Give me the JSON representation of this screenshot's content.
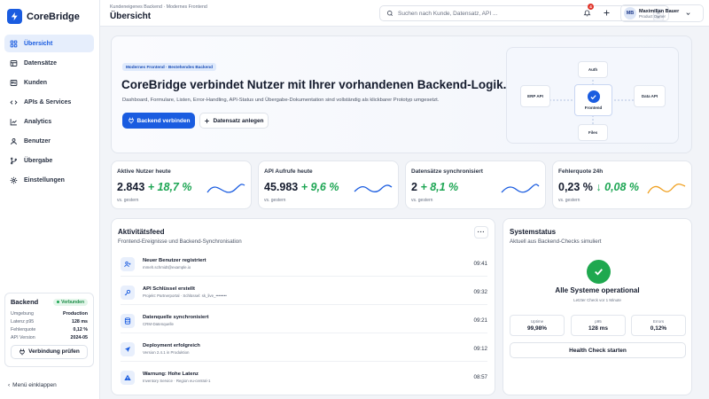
{
  "brand": {
    "name": "CoreBridge",
    "accent": "#1a5ce0",
    "success": "#1ea654",
    "warning": "#f0a020",
    "icon": "bolt-icon"
  },
  "sidebar": {
    "items": [
      {
        "label": "Übersicht",
        "icon": "grid-icon",
        "active": true
      },
      {
        "label": "Datensätze",
        "icon": "table-icon"
      },
      {
        "label": "Kunden",
        "icon": "user-icon"
      },
      {
        "label": "APIs & Services",
        "icon": "code-icon"
      },
      {
        "label": "Analytics",
        "icon": "chart-icon"
      },
      {
        "label": "Benutzer",
        "icon": "person-icon"
      },
      {
        "label": "Übergabe",
        "icon": "branch-icon"
      },
      {
        "label": "Einstellungen",
        "icon": "gear-icon"
      }
    ],
    "backend": {
      "title": "Backend",
      "status": "Verbunden",
      "rows": [
        {
          "k": "Umgebung",
          "v": "Production"
        },
        {
          "k": "Latenz p95",
          "v": "128 ms"
        },
        {
          "k": "Fehlerquote",
          "v": "0,12 %"
        },
        {
          "k": "API Version",
          "v": "2024-05"
        }
      ],
      "button": "Verbindung prüfen"
    },
    "collapse": "Menü einklappen"
  },
  "header": {
    "breadcrumb": "Kundeneigenes Backend · Modernes Frontend",
    "title": "Übersicht",
    "search_placeholder": "Suchen nach Kunde, Datensatz, API ...",
    "search_kbd_1": "⌘",
    "search_kbd_2": "K",
    "notifications": "4",
    "user": {
      "initials": "MB",
      "name": "Maximilian Bauer",
      "role": "Product Owner"
    }
  },
  "hero": {
    "tag": "Modernes Frontend · Bestehendes Backend",
    "headline": "CoreBridge verbindet Nutzer mit Ihrer vorhandenen Backend-Logik.",
    "text": "Dashboard, Formulare, Listen, Error-Handling, API-Status und Übergabe-Dokumentation sind vollständig als klickbarer Prototyp umgesetzt.",
    "primary": "Backend verbinden",
    "secondary": "Datensatz anlegen",
    "diagram": {
      "top": "Auth",
      "left": "ERP API",
      "center": "Frontend",
      "right": "Data API",
      "bottom": "Files"
    }
  },
  "stats": [
    {
      "label": "Aktive Nutzer heute",
      "value": "2.843",
      "delta": "+ 18,7 %",
      "sub": "vs. gestern",
      "color": "#1a5ce0"
    },
    {
      "label": "API Aufrufe heute",
      "value": "45.983",
      "delta": "+ 9,6 %",
      "sub": "vs. gestern",
      "color": "#1a5ce0"
    },
    {
      "label": "Datensätze synchronisiert",
      "value": "2",
      "delta": "+ 8,1 %",
      "sub": "vs. gestern",
      "color": "#1a5ce0"
    },
    {
      "label": "Fehlerquote 24h",
      "value": "0,23 %",
      "delta": "↓ 0,08 %",
      "sub": "vs. gestern",
      "color": "#f0a020"
    }
  ],
  "activity": {
    "title": "Aktivitätsfeed",
    "subtitle": "Frontend-Ereignisse und Backend-Synchronisation",
    "more": "···",
    "items": [
      {
        "icon": "user-plus-icon",
        "title": "Neuer Benutzer registriert",
        "sub": "mmeh.schmidt@example.io",
        "time": "09:41"
      },
      {
        "icon": "key-icon",
        "title": "API Schlüssel erstellt",
        "sub": "Projekt: Partnerportal · Schlüssel: sk_live_••••••••",
        "time": "09:32"
      },
      {
        "icon": "database-icon",
        "title": "Datenquelle synchronisiert",
        "sub": "CRM-Datenquelle",
        "time": "09:21"
      },
      {
        "icon": "rocket-icon",
        "title": "Deployment erfolgreich",
        "sub": "Version 2.4.1 in Produktion",
        "time": "09:12"
      },
      {
        "icon": "warning-icon",
        "title": "Warnung: Hohe Latenz",
        "sub": "Inventory Service · Region eu-central-1",
        "time": "08:57"
      }
    ]
  },
  "system": {
    "title": "Systemstatus",
    "subtitle": "Aktuell aus Backend-Checks simuliert",
    "status": "Alle Systeme operational",
    "last": "Letzter Check vor 1 Minute",
    "metrics": [
      {
        "k": "Uptime",
        "v": "99,98%"
      },
      {
        "k": "p95",
        "v": "128 ms"
      },
      {
        "k": "Errors",
        "v": "0,12%"
      }
    ],
    "button": "Health Check starten"
  }
}
